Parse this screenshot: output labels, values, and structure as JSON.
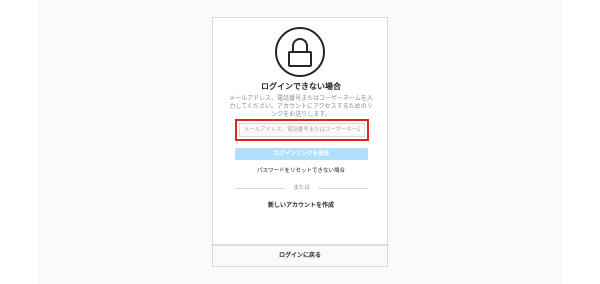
{
  "card": {
    "title": "ログインできない場合",
    "description": "メールアドレス、電話番号またはユーザーネームを入力してください。アカウントにアクセスするためのリンクをお送りします。",
    "input": {
      "placeholder": "メールアドレス、電話番号またはユーザーネーム",
      "value": ""
    },
    "send_button": "ログインリンクを送信",
    "reset_link": "パスワードをリセットできない場合",
    "or_text": "または",
    "create_account": "新しいアカウントを作成"
  },
  "footer": {
    "back_to_login": "ログインに戻る"
  },
  "colors": {
    "highlight_border": "#e0261a",
    "button_disabled": "#b2dffc",
    "border": "#dbdbdb",
    "background": "#fafafa"
  },
  "icons": {
    "lock": "lock-icon"
  }
}
